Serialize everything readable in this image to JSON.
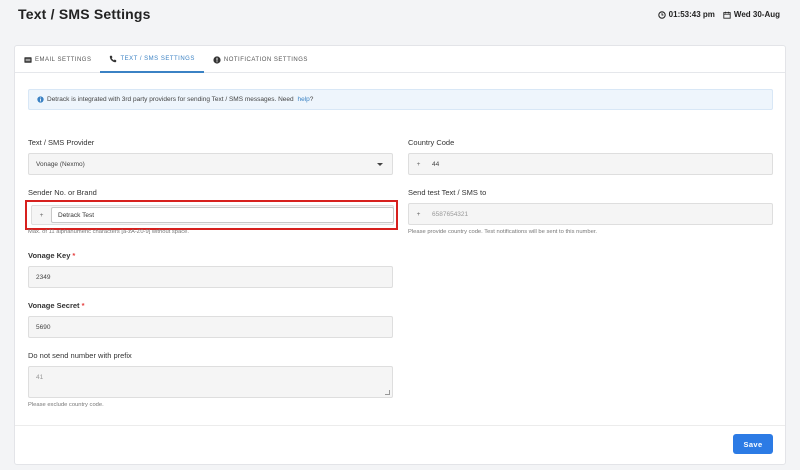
{
  "header": {
    "title": "Text / SMS Settings",
    "time": "01:53:43 pm",
    "date": "Wed 30-Aug"
  },
  "tabs": [
    {
      "label": "EMAIL SETTINGS",
      "icon": "email-icon",
      "active": false
    },
    {
      "label": "TEXT / SMS SETTINGS",
      "icon": "phone-icon",
      "active": true
    },
    {
      "label": "NOTIFICATION SETTINGS",
      "icon": "notification-icon",
      "active": false
    }
  ],
  "info": {
    "text": "Detrack is integrated with 3rd party providers for sending Text / SMS messages. Need ",
    "link": "help",
    "suffix": "?"
  },
  "form": {
    "provider_label": "Text / SMS Provider",
    "provider_value": "Vonage (Nexmo)",
    "sender_label": "Sender No. or Brand",
    "sender_prefix": "+",
    "sender_value": "Detrack Test",
    "sender_hint": "Max. of 11 alphanumeric characters [a-zA-Z0-9] without space.",
    "vonage_key_label": "Vonage Key",
    "vonage_key_value": "2349",
    "vonage_secret_label": "Vonage Secret",
    "vonage_secret_value": "5690",
    "prefix_label": "Do not send number with prefix",
    "prefix_value": "41",
    "prefix_hint": "Please exclude country code.",
    "country_code_label": "Country Code",
    "country_code_prefix": "+",
    "country_code_value": "44",
    "test_label": "Send test Text / SMS to",
    "test_prefix": "+",
    "test_placeholder": "6587654321",
    "test_hint": "Please provide country code. Test notifications will be sent to this number.",
    "required_mark": "*"
  },
  "actions": {
    "save_label": "Save"
  },
  "colors": {
    "accent": "#2c7be5",
    "highlight": "#d7201e",
    "info_bg": "#eef5fc"
  }
}
